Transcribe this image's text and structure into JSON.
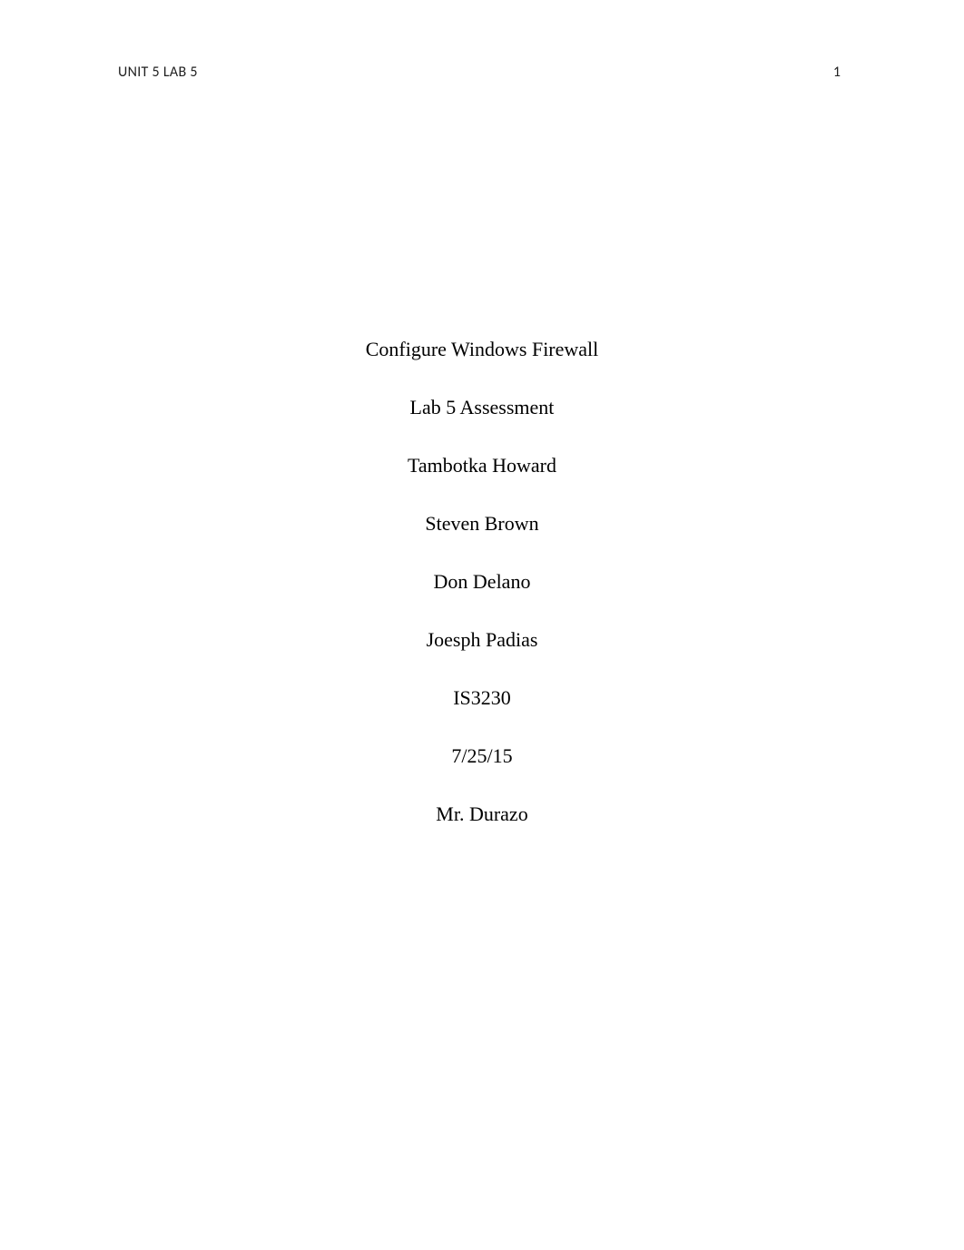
{
  "header": {
    "running_head": "UNIT 5 LAB 5",
    "page_number": "1"
  },
  "content": {
    "title": "Configure Windows Firewall",
    "subtitle": "Lab 5 Assessment",
    "authors": [
      "Tambotka Howard",
      "Steven Brown",
      "Don Delano",
      "Joesph Padias"
    ],
    "course": "IS3230",
    "date": "7/25/15",
    "instructor": "Mr. Durazo"
  }
}
